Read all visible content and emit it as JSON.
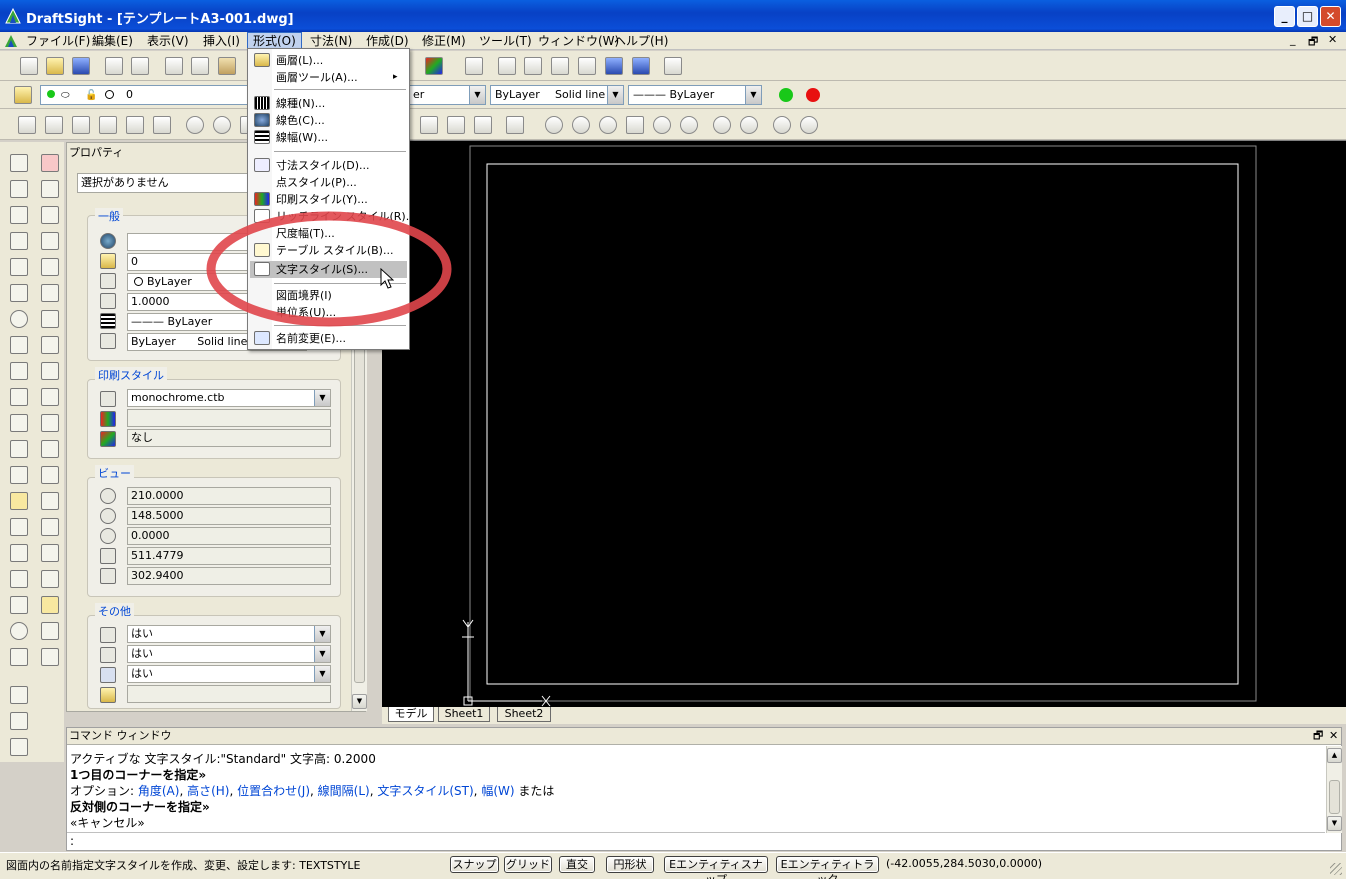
{
  "window": {
    "title": "DraftSight - [テンプレートA3-001.dwg]",
    "minimize": "_",
    "maximize": "□",
    "close": "✕"
  },
  "menubar": {
    "items": [
      "ファイル(F)",
      "編集(E)",
      "表示(V)",
      "挿入(I)",
      "形式(O)",
      "寸法(N)",
      "作成(D)",
      "修正(M)",
      "ツール(T)",
      "ウィンドウ(W)",
      "ヘルプ(H)"
    ],
    "doc_controls": [
      "_",
      "🗗",
      "✕"
    ]
  },
  "layer_toolbar": {
    "layer_value": "0",
    "linetype_partial": "er",
    "color_value": "ByLayer",
    "linestyle_value": "Solid line",
    "lineweight_value": "——— ByLayer",
    "green_color": "#19c819",
    "red_color": "#e81010"
  },
  "properties": {
    "title": "プロパティ",
    "selection": "選択がありません",
    "general": {
      "label": "一般",
      "layer": "0",
      "color": "ByLayer",
      "scale": "1.0000",
      "lineweight": "——— ByLayer",
      "linetype_name": "ByLayer",
      "linetype_style": "Solid line"
    },
    "print_style": {
      "label": "印刷スタイル",
      "table": "monochrome.ctb",
      "style": "",
      "none": "なし"
    },
    "view": {
      "label": "ビュー",
      "center_x": "210.0000",
      "center_y": "148.5000",
      "center_z": "0.0000",
      "width": "511.4779",
      "height": "302.9400"
    },
    "other": {
      "label": "その他",
      "ucs_icon_on": "はい",
      "ucs_icon_origin": "はい",
      "ucs_per_viewport": "はい",
      "ucs_name": ""
    }
  },
  "format_menu": {
    "items": [
      {
        "label": "画層(L)...",
        "icon": "layer-icon"
      },
      {
        "label": "画層ツール(A)...",
        "icon": "",
        "submenu": "▸"
      },
      {
        "label": "線種(N)...",
        "icon": "linetype-icon"
      },
      {
        "label": "線色(C)...",
        "icon": "color-palette-icon"
      },
      {
        "label": "線幅(W)...",
        "icon": "lineweight-icon"
      },
      {
        "label": "寸法スタイル(D)...",
        "icon": "dimension-style-icon"
      },
      {
        "label": "点スタイル(P)...",
        "icon": ""
      },
      {
        "label": "印刷スタイル(Y)...",
        "icon": "print-style-icon"
      },
      {
        "label": "リッチライン スタイル(R)...",
        "icon": "richline-icon"
      },
      {
        "label": "尺度幅(T)...",
        "icon": ""
      },
      {
        "label": "テーブル スタイル(B)...",
        "icon": "table-style-icon"
      },
      {
        "label": "文字スタイル(S)...",
        "icon": "text-style-icon"
      },
      {
        "label": "図面境界(I)",
        "icon": ""
      },
      {
        "label": "単位系(U)...",
        "icon": ""
      },
      {
        "label": "名前変更(E)...",
        "icon": "rename-icon"
      }
    ],
    "highlight_color": "#e0464b"
  },
  "drawing_tabs": [
    "モデル",
    "Sheet1",
    "Sheet2"
  ],
  "command_window": {
    "title": "コマンド ウィンドウ",
    "line1": "アクティブな 文字スタイル:\"Standard\" 文字高: 0.2000",
    "line2": "1つ目のコーナーを指定»",
    "line3_prefix": "オプション: ",
    "options": [
      "角度(A)",
      "高さ(H)",
      "位置合わせ(J)",
      "線間隔(L)",
      "文字スタイル(ST)",
      "幅(W)"
    ],
    "line3_suffix": " または",
    "line4": "反対側のコーナーを指定»",
    "line5": "«キャンセル»",
    "prompt": ":"
  },
  "statusbar": {
    "message": "図面内の名前指定文字スタイルを作成、変更、設定します:  TEXTSTYLE",
    "buttons": [
      "スナップ",
      "グリッド",
      "直交",
      "円形状",
      "Eエンティティスナップ",
      "Eエンティティトラック"
    ],
    "coords": "(-42.0055,284.5030,0.0000)"
  }
}
